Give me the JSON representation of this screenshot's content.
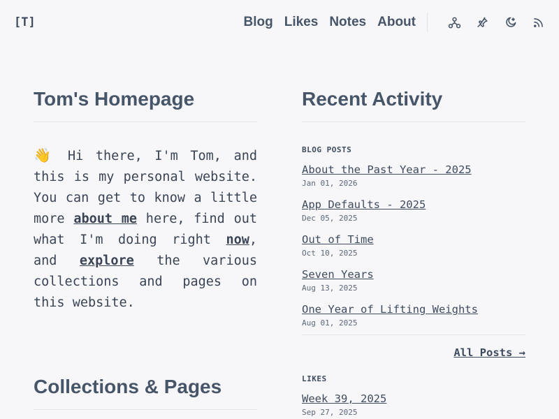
{
  "header": {
    "logo": "[T]",
    "nav": [
      "Blog",
      "Likes",
      "Notes",
      "About"
    ],
    "icons": [
      "network-icon",
      "pin-icon",
      "moon-icon",
      "rss-icon"
    ]
  },
  "left": {
    "title": "Tom's Homepage",
    "intro": {
      "wave": "👋",
      "part1": " Hi there, I'm Tom, and this is my personal website. You can get to know a little more ",
      "link_about": "about me",
      "part2": " here, find out what I'm doing right ",
      "link_now": "now",
      "part3": ", and ",
      "link_explore": "explore",
      "part4": " the various collections and pages on this website."
    },
    "collections_title": "Collections & Pages"
  },
  "right": {
    "title": "Recent Activity",
    "blog_label": "BLOG POSTS",
    "posts": [
      {
        "title": "About the Past Year - 2025",
        "date": "Jan 01, 2026"
      },
      {
        "title": "App Defaults - 2025",
        "date": "Dec 05, 2025"
      },
      {
        "title": "Out of Time",
        "date": "Oct 10, 2025"
      },
      {
        "title": "Seven Years",
        "date": "Aug 13, 2025"
      },
      {
        "title": "One Year of Lifting Weights",
        "date": "Aug 01, 2025"
      }
    ],
    "all_posts": "All Posts →",
    "likes_label": "LIKES",
    "likes": [
      {
        "title": "Week 39, 2025",
        "date": "Sep 27, 2025"
      }
    ]
  }
}
